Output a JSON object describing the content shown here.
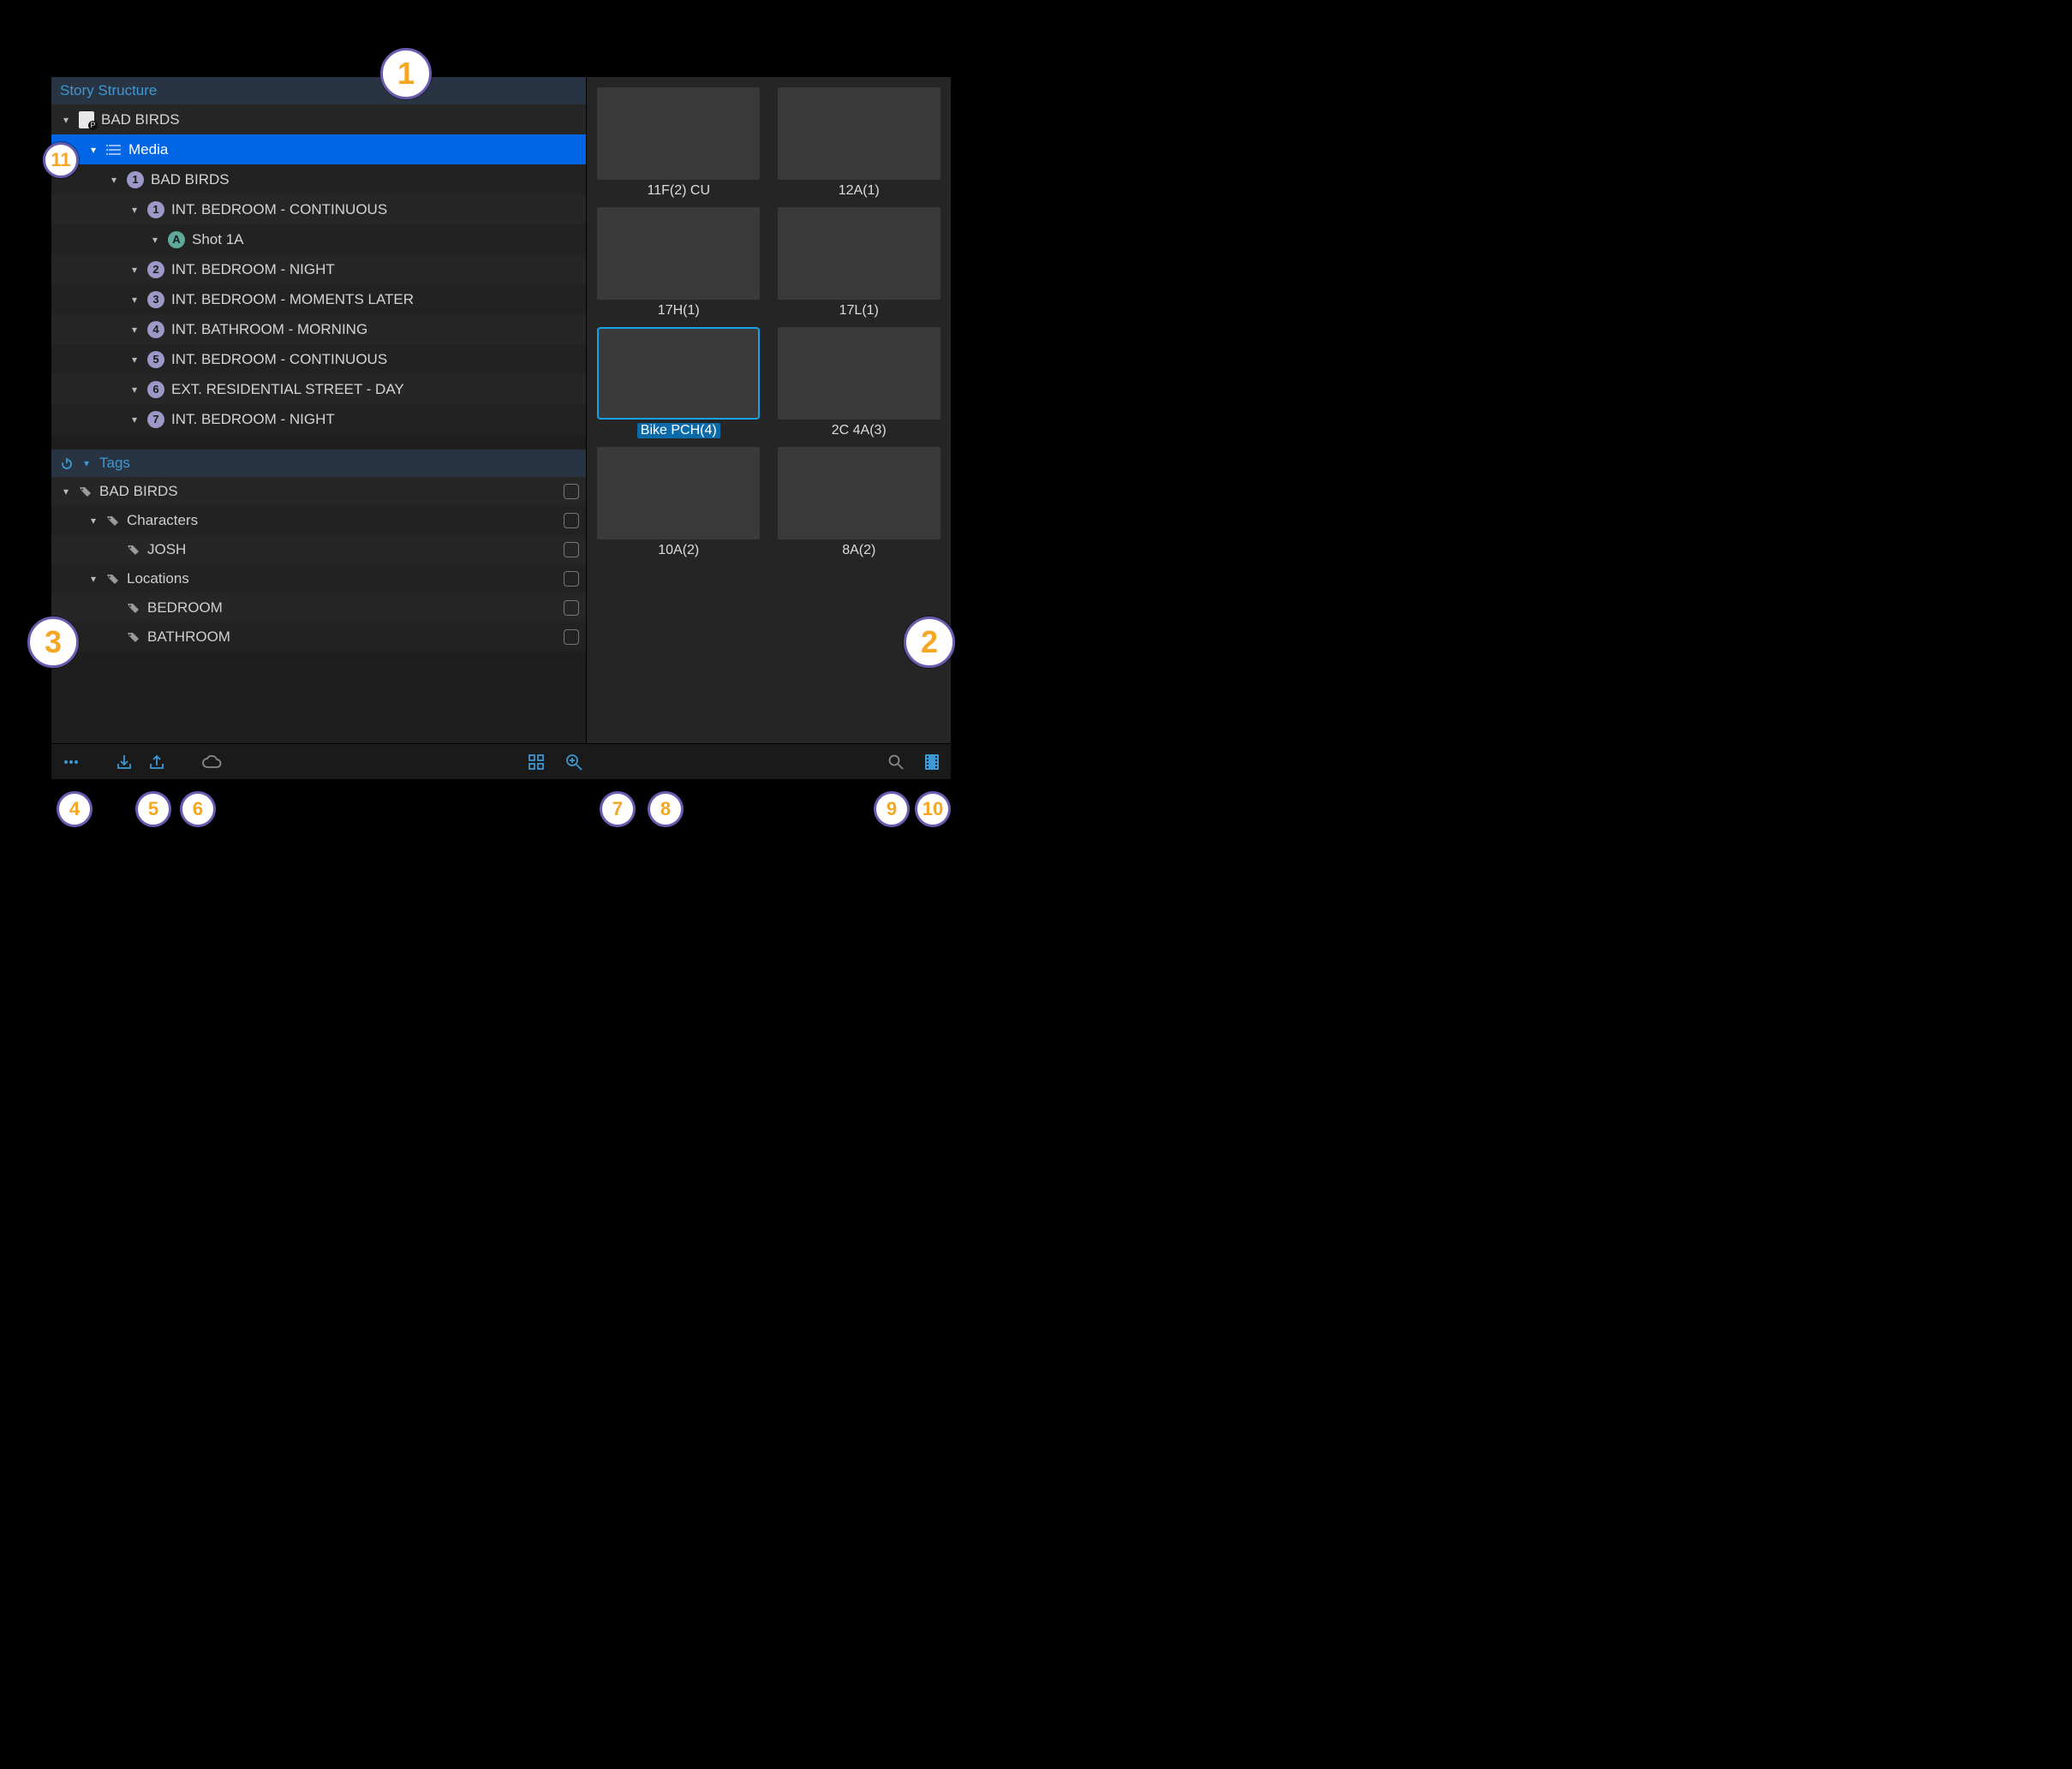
{
  "story_structure": {
    "header": "Story Structure",
    "project": {
      "label": "BAD BIRDS"
    },
    "media": {
      "label": "Media"
    },
    "act": {
      "badge": "1",
      "label": "BAD BIRDS"
    },
    "scenes": [
      {
        "badge": "1",
        "label": "INT. BEDROOM - CONTINUOUS",
        "shot": {
          "badge": "A",
          "label": "Shot 1A"
        }
      },
      {
        "badge": "2",
        "label": "INT. BEDROOM - NIGHT"
      },
      {
        "badge": "3",
        "label": "INT. BEDROOM - MOMENTS LATER"
      },
      {
        "badge": "4",
        "label": "INT. BATHROOM - MORNING"
      },
      {
        "badge": "5",
        "label": "INT. BEDROOM - CONTINUOUS"
      },
      {
        "badge": "6",
        "label": "EXT. RESIDENTIAL STREET - DAY"
      },
      {
        "badge": "7",
        "label": "INT. BEDROOM - NIGHT"
      }
    ]
  },
  "tags_panel": {
    "header": "Tags",
    "root": {
      "label": "BAD BIRDS"
    },
    "characters": {
      "label": "Characters",
      "items": [
        {
          "label": "JOSH"
        }
      ]
    },
    "locations": {
      "label": "Locations",
      "items": [
        {
          "label": "BEDROOM"
        },
        {
          "label": "BATHROOM"
        }
      ]
    }
  },
  "thumbnails": [
    {
      "label": "11F(2) CU",
      "selected": false,
      "tone": "g1"
    },
    {
      "label": "12A(1)",
      "selected": false,
      "tone": "g2"
    },
    {
      "label": "17H(1)",
      "selected": false,
      "tone": "g3"
    },
    {
      "label": "17L(1)",
      "selected": false,
      "tone": "g4"
    },
    {
      "label": "Bike PCH(4)",
      "selected": true,
      "tone": "g5"
    },
    {
      "label": "2C 4A(3)",
      "selected": false,
      "tone": "g6"
    },
    {
      "label": "10A(2)",
      "selected": false,
      "tone": "g7"
    },
    {
      "label": "8A(2)",
      "selected": false,
      "tone": "g8"
    }
  ],
  "toolbar": {
    "more": "more-icon",
    "import": "import-icon",
    "export": "export-icon",
    "cloud": "cloud-icon",
    "grid": "grid-view-icon",
    "zoom_in": "zoom-in-icon",
    "search": "search-icon",
    "filmstrip": "filmstrip-icon"
  },
  "callouts": {
    "c1": "1",
    "c2": "2",
    "c3": "3",
    "c4": "4",
    "c5": "5",
    "c6": "6",
    "c7": "7",
    "c8": "8",
    "c9": "9",
    "c10": "10",
    "c11": "11"
  }
}
